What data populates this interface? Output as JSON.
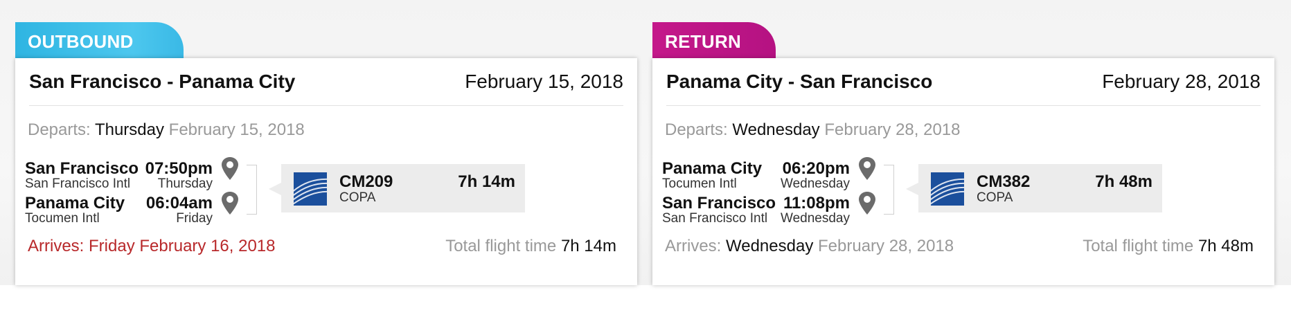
{
  "outbound": {
    "tab_label": "OUTBOUND",
    "route": "San Francisco - Panama City",
    "header_date": "February 15, 2018",
    "departs_label": "Departs:",
    "departs_day": "Thursday",
    "departs_date": "February 15, 2018",
    "origin_city": "San Francisco",
    "origin_airport": "San Francisco Intl",
    "depart_time": "07:50pm",
    "depart_weekday": "Thursday",
    "dest_city": "Panama City",
    "dest_airport": "Tocumen Intl",
    "arrive_time": "06:04am",
    "arrive_weekday": "Friday",
    "flight_number": "CM209",
    "carrier": "COPA",
    "duration": "7h 14m",
    "arrives_label": "Arrives:",
    "arrives_day": "Friday",
    "arrives_date": "February 16, 2018",
    "total_label": "Total flight time",
    "total_value": "7h 14m"
  },
  "return": {
    "tab_label": "RETURN",
    "route": "Panama City - San Francisco",
    "header_date": "February 28, 2018",
    "departs_label": "Departs:",
    "departs_day": "Wednesday",
    "departs_date": "February 28, 2018",
    "origin_city": "Panama City",
    "origin_airport": "Tocumen Intl",
    "depart_time": "06:20pm",
    "depart_weekday": "Wednesday",
    "dest_city": "San Francisco",
    "dest_airport": "San Francisco Intl",
    "arrive_time": "11:08pm",
    "arrive_weekday": "Wednesday",
    "flight_number": "CM382",
    "carrier": "COPA",
    "duration": "7h 48m",
    "arrives_label": "Arrives:",
    "arrives_day": "Wednesday",
    "arrives_date": "February 28, 2018",
    "total_label": "Total flight time",
    "total_value": "7h 48m"
  },
  "colors": {
    "outbound_tab": "#3ab9e6",
    "return_tab": "#c4188a",
    "arrival_warning": "#b8282a",
    "airline_logo": "#1b4f9c"
  }
}
